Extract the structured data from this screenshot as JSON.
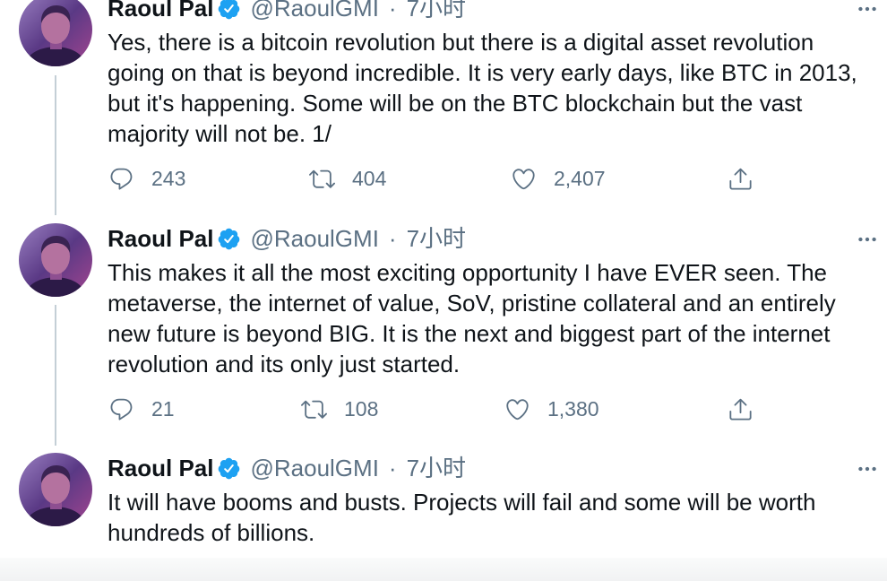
{
  "tweets": [
    {
      "author": {
        "name": "Raoul Pal",
        "verified": true,
        "handle": "@RaoulGMI",
        "separator": "·",
        "time": "7小时"
      },
      "lines": [
        "Yes, there is a bitcoin revolution but there is a digital asset revolution",
        "going on that is beyond incredible. It is very early days, like BTC in 2013,",
        "but it's happening. Some will be on the BTC blockchain but the vast",
        "majority will not be. 1/"
      ],
      "stats": {
        "replies": "243",
        "retweets": "404",
        "likes": "2,407"
      }
    },
    {
      "author": {
        "name": "Raoul Pal",
        "verified": true,
        "handle": "@RaoulGMI",
        "separator": "·",
        "time": "7小时"
      },
      "lines": [
        "This makes it all the most exciting opportunity I have EVER seen. The",
        "metaverse, the internet of value, SoV, pristine collateral and an entirely",
        "new future is beyond BIG. It is the next and biggest part of the internet",
        "revolution and its only just started."
      ],
      "stats": {
        "replies": "21",
        "retweets": "108",
        "likes": "1,380"
      }
    },
    {
      "author": {
        "name": "Raoul Pal",
        "verified": true,
        "handle": "@RaoulGMI",
        "separator": "·",
        "time": "7小时"
      },
      "lines": [
        "It will have booms and busts. Projects will fail and some will be worth",
        "hundreds of billions."
      ]
    }
  ],
  "icons": {
    "reply": "reply-icon",
    "retweet": "retweet-icon",
    "like": "like-icon",
    "share": "share-icon",
    "more": "more-icon",
    "verified": "verified-badge-icon"
  },
  "colors": {
    "text": "#0f1419",
    "secondary_text": "#5b7083",
    "verified_badge": "#1da1f2",
    "thread_line": "#c4cfd6"
  }
}
